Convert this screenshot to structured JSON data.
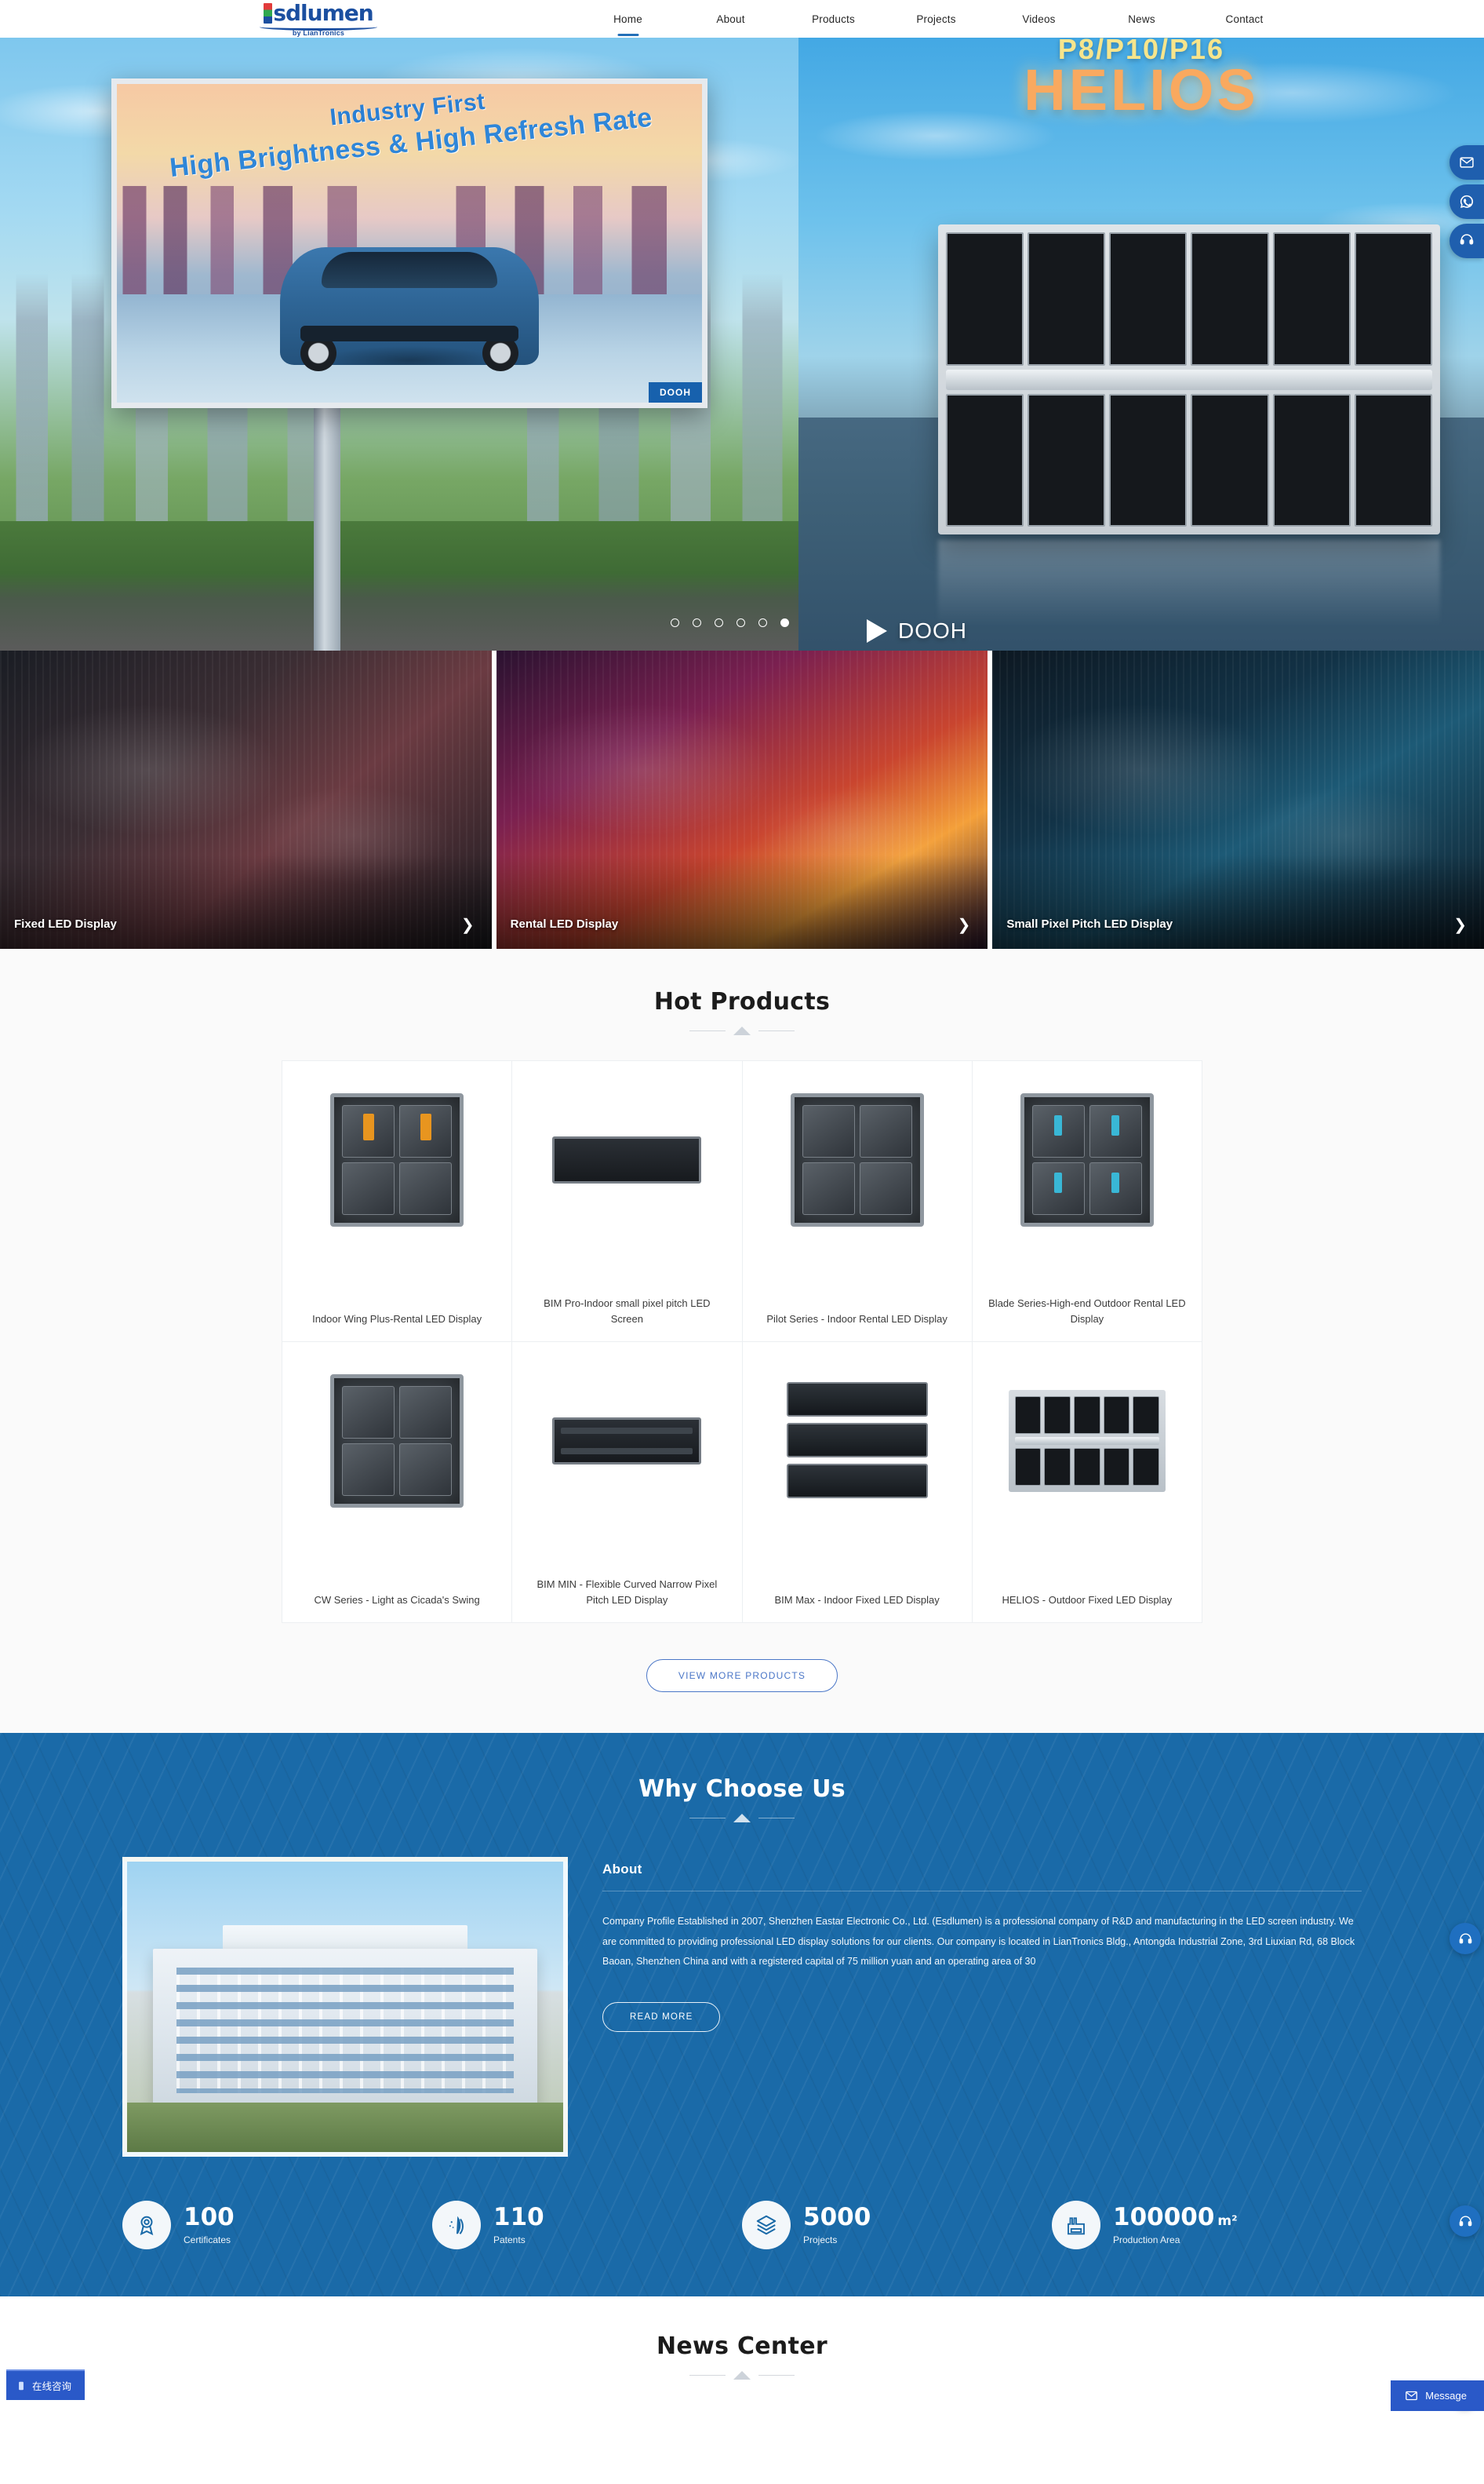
{
  "brand": {
    "logo_text": "sdlumen",
    "logo_tagline": "by LianTronics"
  },
  "nav": {
    "items": [
      {
        "label": "Home",
        "active": true
      },
      {
        "label": "About",
        "active": false
      },
      {
        "label": "Products",
        "active": false
      },
      {
        "label": "Projects",
        "active": false
      },
      {
        "label": "Videos",
        "active": false
      },
      {
        "label": "News",
        "active": false
      },
      {
        "label": "Contact",
        "active": false
      }
    ]
  },
  "hero": {
    "billboard_line1": "Industry First",
    "billboard_line2": "High Brightness & High Refresh Rate",
    "billboard_tag": "DOOH",
    "right_subtitle": "P8/P10/P16",
    "right_title": "HELIOS",
    "play_label": "DOOH",
    "dots": [
      {
        "active": false
      },
      {
        "active": false
      },
      {
        "active": false
      },
      {
        "active": false
      },
      {
        "active": false
      },
      {
        "active": true
      }
    ]
  },
  "categories": [
    {
      "label": "Fixed LED Display",
      "arrow": "❯"
    },
    {
      "label": "Rental LED Display",
      "arrow": "❯"
    },
    {
      "label": "Small Pixel Pitch LED Display",
      "arrow": "❯"
    }
  ],
  "hot_products": {
    "title": "Hot Products",
    "view_more_label": "VIEW MORE PRODUCTS",
    "items": [
      {
        "name": "Indoor Wing Plus-Rental LED Display",
        "style": "cabinet-accent"
      },
      {
        "name": "BIM Pro-Indoor small pixel pitch LED Screen",
        "style": "slim-panel"
      },
      {
        "name": "Pilot Series - Indoor Rental LED Display",
        "style": "cabinet-plain"
      },
      {
        "name": "Blade Series-High-end Outdoor Rental LED Display",
        "style": "cabinet-cyan"
      },
      {
        "name": "CW Series - Light as Cicada's Swing",
        "style": "cabinet-plain"
      },
      {
        "name": "BIM MIN - Flexible Curved Narrow Pixel Pitch LED Display",
        "style": "slim-bars"
      },
      {
        "name": "BIM Max - Indoor Fixed LED Display",
        "style": "stack-rows"
      },
      {
        "name": "HELIOS - Outdoor Fixed LED Display",
        "style": "wide-cabinet"
      }
    ]
  },
  "why_choose_us": {
    "title": "Why Choose Us",
    "about_heading": "About",
    "about_text": "Company Profile Established in 2007, Shenzhen Eastar Electronic Co., Ltd. (Esdlumen) is a professional company of R&D and manufacturing in the LED screen industry. We are committed to providing professional LED display solutions for our clients. Our company is located in LianTronics Bldg., Antongda Industrial Zone, 3rd Liuxian Rd, 68 Block Baoan, Shenzhen China and with a registered capital of 75 million yuan and an operating area of 30",
    "read_more_label": "READ MORE",
    "stats": [
      {
        "icon": "medal-icon",
        "value": "100",
        "unit": "",
        "label": "Certificates"
      },
      {
        "icon": "patent-icon",
        "value": "110",
        "unit": "",
        "label": "Patents"
      },
      {
        "icon": "layers-icon",
        "value": "5000",
        "unit": "",
        "label": "Projects"
      },
      {
        "icon": "factory-icon",
        "value": "100000",
        "unit": "m²",
        "label": "Production Area"
      }
    ]
  },
  "news": {
    "title": "News Center"
  },
  "widgets": {
    "side_buttons": [
      {
        "icon": "mail-icon"
      },
      {
        "icon": "whatsapp-icon"
      },
      {
        "icon": "phone-icon"
      }
    ],
    "chat_icon": "headset-icon",
    "back_to_top_icon": "chevron-up-icon",
    "kefu_label": "在线咨询",
    "message_label": "Message"
  },
  "colors": {
    "brand_blue": "#1b4fa0",
    "accent_blue": "#2470b8",
    "section_blue": "#1a6aa8",
    "button_blue": "#2a59c8"
  }
}
